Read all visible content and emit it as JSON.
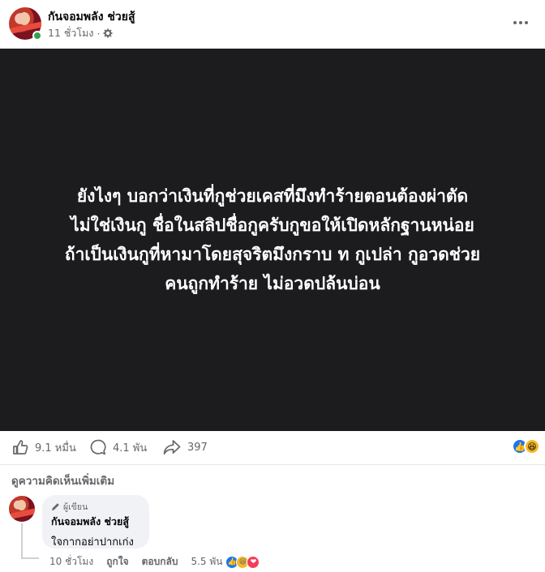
{
  "post": {
    "author": "กันจอมพลัง ช่วยสู้",
    "time": "11 ชั่วโมง",
    "privacy_icon": "gear-icon",
    "text_lines": [
      "ยังไงๆ บอกว่าเงินที่กูช่วยเคสที่มึงทำร้ายตอนต้องผ่าตัด",
      "ไม่ใช่เงินกู ชื่อในสลิปชื่อกูครับกูขอให้เปิดหลักฐานหน่อย",
      "ถ้าเป็นเงินกูที่หามาโดยสุจริตมึงกราบ ท กูเปล่า กูอวดช่วย",
      "คนถูกทำร้าย ไม่อวดปล้นบ่อน"
    ],
    "background_color": "#1c1c1e"
  },
  "actions": {
    "likes": "9.1 หมื่น",
    "comments": "4.1 พัน",
    "shares": "397"
  },
  "reactions": [
    "like",
    "haha"
  ],
  "comments_section": {
    "more_label": "ดูความคิดเห็นเพิ่มเติม",
    "comment": {
      "badge": "ผู้เขียน",
      "author": "กันจอมพลัง ช่วยสู้",
      "text": "ใจกากอย่าปากเก่ง",
      "time": "10 ชั่วโมง",
      "like_label": "ถูกใจ",
      "reply_label": "ตอบกลับ",
      "reaction_count": "5.5 พัน",
      "reactions": [
        "like",
        "haha",
        "love"
      ]
    }
  },
  "colors": {
    "accent": "#1877f2",
    "online": "#31a24c",
    "muted_text": "#65676b"
  }
}
